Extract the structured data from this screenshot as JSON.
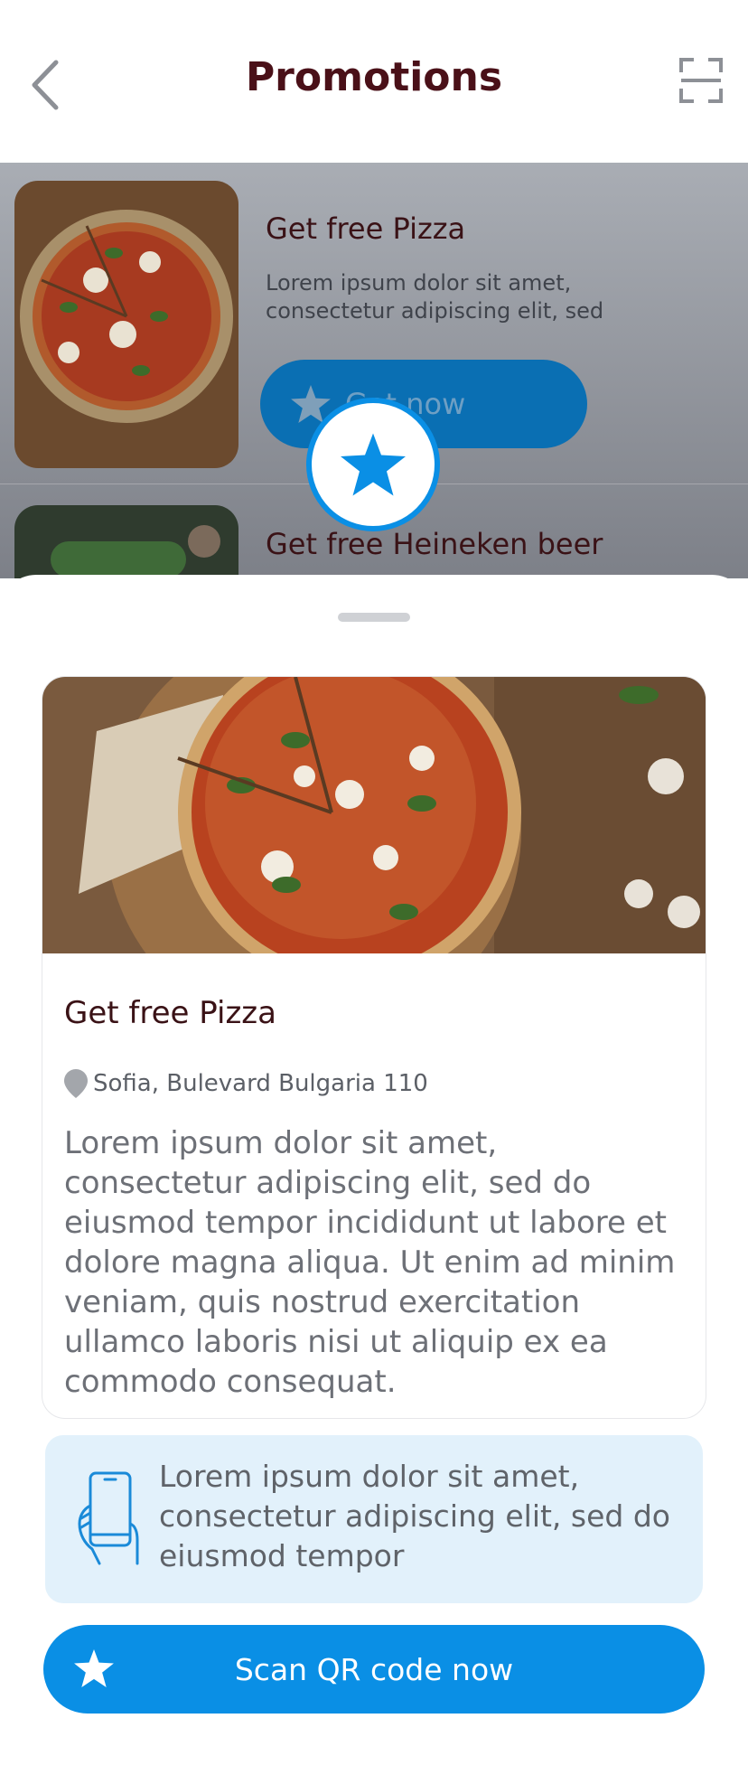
{
  "header": {
    "title": "Promotions",
    "back_icon": "chevron-left-icon",
    "scan_icon": "scan-frame-icon"
  },
  "promotions": [
    {
      "title": "Get free Pizza",
      "description": "Lorem ipsum dolor sit amet, consectetur adipiscing elit, sed",
      "button_label": "Get now",
      "button_icon": "star-icon"
    },
    {
      "title": "Get free Heineken beer"
    }
  ],
  "detail": {
    "title": "Get free Pizza",
    "location_icon": "map-pin-icon",
    "location": "Sofia, Bulevard Bulgaria 110",
    "description": "Lorem ipsum dolor sit amet, consectetur adipiscing elit, sed do eiusmod tempor incididunt ut labore et dolore magna aliqua. Ut enim ad minim veniam, quis nostrud exercitation ullamco laboris nisi ut aliquip ex ea commodo consequat."
  },
  "info": {
    "icon": "phone-in-hand-icon",
    "text": "Lorem ipsum dolor sit amet, consectetur adipiscing elit, sed do eiusmod tempor"
  },
  "cta": {
    "label": "Scan QR code now",
    "icon": "star-icon"
  },
  "colors": {
    "accent": "#0a8fe5",
    "title": "#4a1018",
    "info_bg": "#e2f1fb"
  }
}
